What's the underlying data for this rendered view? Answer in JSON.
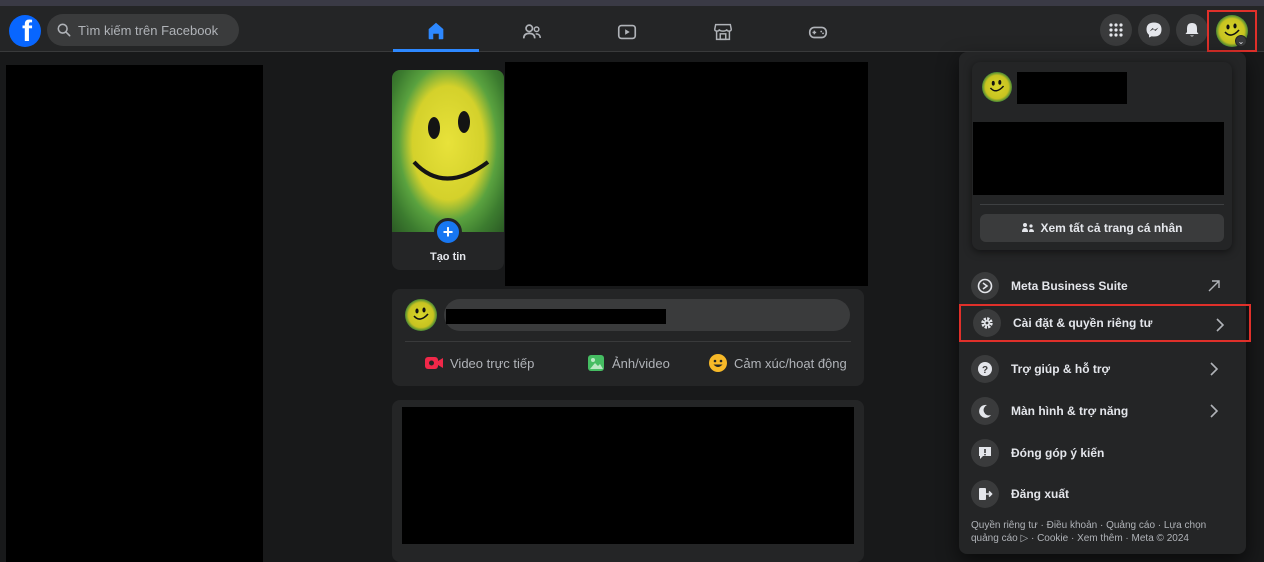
{
  "search": {
    "placeholder": "Tìm kiếm trên Facebook"
  },
  "nav": {
    "tabs": [
      {
        "name": "home",
        "icon": "home-icon",
        "active": true
      },
      {
        "name": "friends",
        "icon": "friends-icon",
        "active": false
      },
      {
        "name": "video",
        "icon": "video-icon",
        "active": false
      },
      {
        "name": "marketplace",
        "icon": "marketplace-icon",
        "active": false
      },
      {
        "name": "gaming",
        "icon": "gaming-icon",
        "active": false
      }
    ]
  },
  "header_icons": [
    "menu-grid-icon",
    "messenger-icon",
    "bell-icon",
    "profile-avatar"
  ],
  "stories": {
    "create_label": "Tạo tin"
  },
  "composer": {
    "actions": [
      {
        "label": "Video trực tiếp",
        "icon": "live-video-icon",
        "color": "#f02849"
      },
      {
        "label": "Ảnh/video",
        "icon": "photo-icon",
        "color": "#45bd62"
      },
      {
        "label": "Cảm xúc/hoạt động",
        "icon": "feeling-icon",
        "color": "#f7b928"
      }
    ]
  },
  "dropdown": {
    "see_all_profiles": "Xem tất cả trang cá nhân",
    "items": [
      {
        "label": "Meta Business Suite",
        "icon": "meta-business-icon",
        "trailing": "external-arrow"
      },
      {
        "label": "Cài đặt & quyền riêng tư",
        "icon": "gear-icon",
        "trailing": "chevron-right",
        "highlighted": true
      },
      {
        "label": "Trợ giúp & hỗ trợ",
        "icon": "help-icon",
        "trailing": "chevron-right"
      },
      {
        "label": "Màn hình & trợ năng",
        "icon": "moon-icon",
        "trailing": "chevron-right"
      },
      {
        "label": "Đóng góp ý kiến",
        "icon": "feedback-icon",
        "trailing": "none"
      },
      {
        "label": "Đăng xuất",
        "icon": "logout-icon",
        "trailing": "none"
      }
    ],
    "footer": {
      "line1": "Quyền riêng tư · Điều khoản · Quảng cáo · Lựa chọn",
      "line2": "quảng cáo ▷ · Cookie · Xem thêm · Meta © 2024"
    }
  },
  "colors": {
    "accent": "#2d88ff",
    "highlight_box": "#e0302a",
    "background": "#18191a",
    "card": "#242526"
  }
}
